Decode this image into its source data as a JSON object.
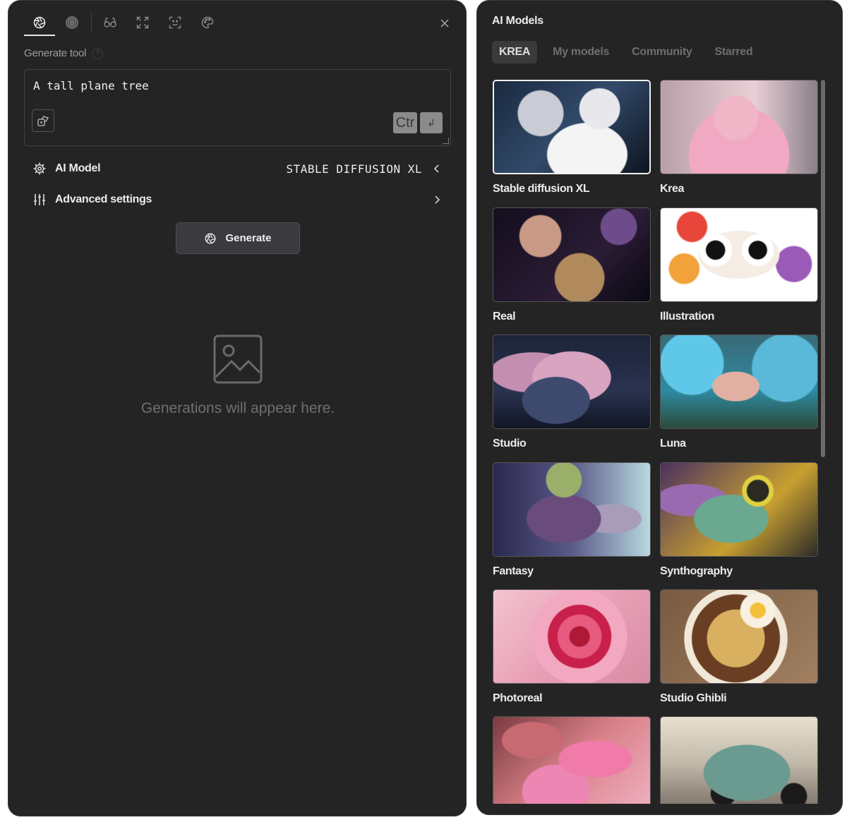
{
  "toolbar": {
    "tools": [
      "aperture-icon",
      "spiral-icon",
      "glasses-icon",
      "expand-icon",
      "face-scan-icon",
      "palette-icon"
    ],
    "active_tool": "aperture-icon"
  },
  "generate": {
    "section_label": "Generate tool",
    "help_glyph": "?",
    "prompt_value": "A tall plane tree",
    "kbd_ctrl": "Ctr",
    "kbd_enter": "↲",
    "ai_model_label": "AI Model",
    "ai_model_value": "STABLE DIFFUSION XL",
    "advanced_label": "Advanced settings",
    "generate_button": "Generate",
    "empty_message": "Generations will appear here."
  },
  "models_panel": {
    "title": "AI Models",
    "tabs": [
      {
        "label": "KREA",
        "active": true
      },
      {
        "label": "My models",
        "active": false
      },
      {
        "label": "Community",
        "active": false
      },
      {
        "label": "Starred",
        "active": false
      }
    ],
    "models": [
      {
        "label": "Stable diffusion XL",
        "selected": true
      },
      {
        "label": "Krea",
        "selected": false
      },
      {
        "label": "Real",
        "selected": false
      },
      {
        "label": "Illustration",
        "selected": false
      },
      {
        "label": "Studio",
        "selected": false
      },
      {
        "label": "Luna",
        "selected": false
      },
      {
        "label": "Fantasy",
        "selected": false
      },
      {
        "label": "Synthography",
        "selected": false
      },
      {
        "label": "Photoreal",
        "selected": false
      },
      {
        "label": "Studio Ghibli",
        "selected": false
      },
      {
        "label": "",
        "selected": false
      },
      {
        "label": "",
        "selected": false
      }
    ]
  }
}
